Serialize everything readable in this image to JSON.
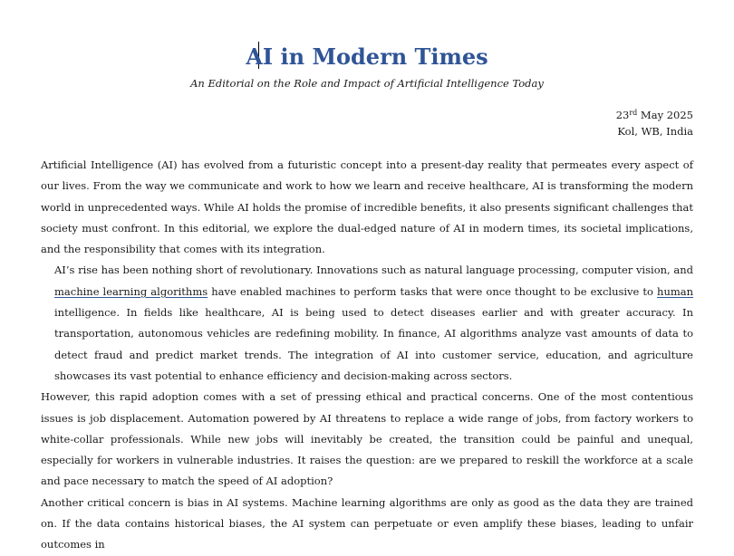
{
  "document": {
    "title": "AI in Modern Times",
    "subtitle": "An Editorial on the Role and Impact of Artificial Intelligence Today",
    "date_day": "23",
    "date_suffix": "rd",
    "date_rest": " May 2025",
    "location": "Kol, WB, India",
    "paragraphs": {
      "p1": "Artificial Intelligence (AI) has evolved from a futuristic concept into a present-day reality that permeates every aspect of our lives. From the way we communicate and work to how we learn and receive healthcare, AI is transforming the modern world in unprecedented ways. While AI holds the promise of incredible benefits, it also presents significant challenges that society must confront. In this editorial, we explore the dual-edged nature of AI in modern times, its societal implications, and the responsibility that comes with its integration.",
      "p2_a": "AI’s rise has been nothing short of revolutionary. Innovations such as natural language processing, computer vision, and ",
      "p2_link1": "machine learning algorithms",
      "p2_b": " have enabled machines to perform tasks that were once thought to be exclusive to ",
      "p2_link2": "human",
      "p2_c": " intelligence. In fields like healthcare, AI is being used to detect diseases earlier and with greater accuracy. In transportation, autonomous vehicles are redefining mobility. In finance, AI algorithms analyze vast amounts of data to detect fraud and predict market trends. The integration of AI into customer service, education, and agriculture showcases its vast potential to enhance efficiency and decision-making across sectors.",
      "p3": "However, this rapid adoption comes with a set of pressing ethical and practical concerns. One of the most contentious issues is job displacement. Automation powered by AI threatens to replace a wide range of jobs, from factory workers to white-collar professionals. While new jobs will inevitably be created, the transition could be painful and unequal, especially for workers in vulnerable industries. It raises the question: are we prepared to reskill the workforce at a scale and pace necessary to match the speed of AI adoption?",
      "p4": "Another critical concern is bias in AI systems. Machine learning algorithms are only as good as the data they are trained on. If the data contains historical biases, the AI system can perpetuate or even amplify these biases, leading to unfair outcomes in"
    }
  },
  "colors": {
    "title": "#2f5496",
    "text": "#1a1a1a"
  }
}
